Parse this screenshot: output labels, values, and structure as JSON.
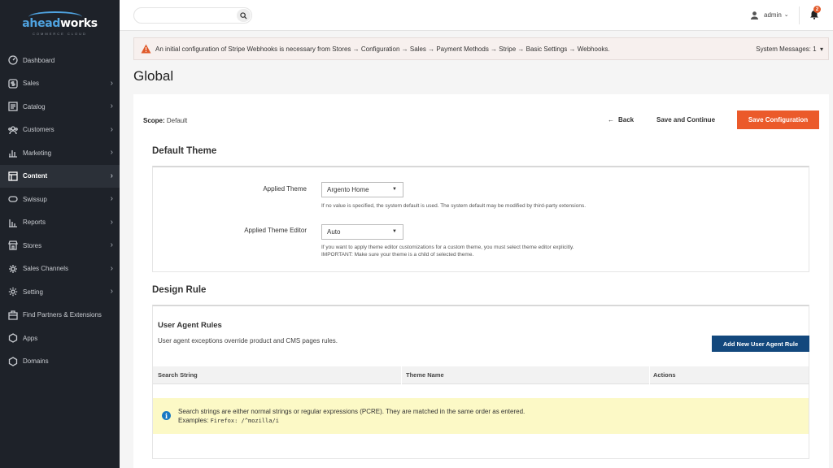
{
  "logo": {
    "part1": "ahead",
    "part2": "works",
    "subtitle": "COMMERCE CLOUD"
  },
  "sidebar": {
    "items": [
      {
        "label": "Dashboard",
        "icon": "dashboard-icon",
        "arrow": ""
      },
      {
        "label": "Sales",
        "icon": "dollar-icon",
        "arrow": "›"
      },
      {
        "label": "Catalog",
        "icon": "catalog-icon",
        "arrow": "›"
      },
      {
        "label": "Customers",
        "icon": "customers-icon",
        "arrow": "›"
      },
      {
        "label": "Marketing",
        "icon": "marketing-icon",
        "arrow": "›"
      },
      {
        "label": "Content",
        "icon": "content-icon",
        "arrow": "›"
      },
      {
        "label": "Swissup",
        "icon": "swissup-icon",
        "arrow": "›"
      },
      {
        "label": "Reports",
        "icon": "reports-icon",
        "arrow": "›"
      },
      {
        "label": "Stores",
        "icon": "stores-icon",
        "arrow": "›"
      },
      {
        "label": "Sales Channels",
        "icon": "channels-icon",
        "arrow": "›"
      },
      {
        "label": "Setting",
        "icon": "gear-icon",
        "arrow": "›"
      },
      {
        "label": "Find Partners & Extensions",
        "icon": "partners-icon",
        "arrow": ""
      },
      {
        "label": "Apps",
        "icon": "apps-icon",
        "arrow": ""
      },
      {
        "label": "Domains",
        "icon": "domains-icon",
        "arrow": ""
      }
    ],
    "active_index": 5
  },
  "header": {
    "search_placeholder": "",
    "user": "admin",
    "notification_count": "2"
  },
  "notice": {
    "text": "An initial configuration of Stripe Webhooks is necessary from Stores → Configuration → Sales → Payment Methods → Stripe → Basic Settings → Webhooks.",
    "system_messages": "System Messages: 1"
  },
  "page": {
    "title": "Global"
  },
  "toolbar": {
    "scope_label": "Scope:",
    "scope_value": "Default",
    "back": "Back",
    "save_continue": "Save and Continue",
    "save_config": "Save Configuration"
  },
  "default_theme": {
    "title": "Default Theme",
    "applied_theme_label": "Applied Theme",
    "applied_theme_value": "Argento Home",
    "applied_theme_hint": "If no value is specified, the system default is used. The system default may be modified by third-party extensions.",
    "editor_label": "Applied Theme Editor",
    "editor_value": "Auto",
    "editor_hint_1": "If you want to apply theme editor customizations for a custom theme, you must select theme editor explicitly.",
    "editor_hint_2": "IMPORTANT: Make sure your theme is a child of selected theme."
  },
  "design_rule": {
    "title": "Design Rule",
    "ua_title": "User Agent Rules",
    "ua_desc": "User agent exceptions override product and CMS pages rules.",
    "add_button": "Add New User Agent Rule",
    "columns": [
      "Search String",
      "Theme Name",
      "Actions"
    ],
    "info_line1": "Search strings are either normal strings or regular expressions (PCRE). They are matched in the same order as entered.",
    "info_examples_label": "Examples:",
    "info_example_1": "Firefox",
    "info_example_2": "/^mozilla/i"
  },
  "colors": {
    "accent": "#eb5a2a",
    "primary": "#13487d",
    "sidebar": "#1e2229"
  }
}
